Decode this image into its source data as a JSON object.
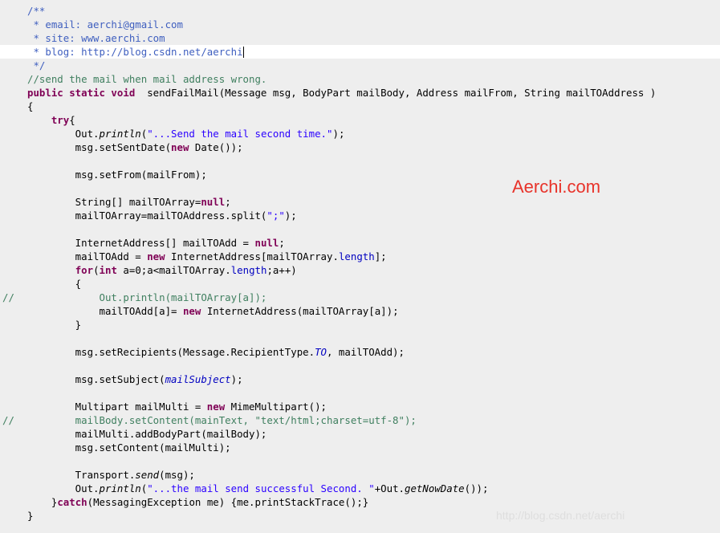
{
  "editor": {
    "lines": [
      {
        "gutter": "",
        "parts": [
          [
            "jd",
            "/**"
          ]
        ]
      },
      {
        "gutter": "",
        "parts": [
          [
            "jd",
            " * email: aerchi@gmail.com"
          ]
        ]
      },
      {
        "gutter": "",
        "parts": [
          [
            "jd",
            " * site: www.aerchi.com"
          ]
        ]
      },
      {
        "gutter": "",
        "current": true,
        "caret": true,
        "parts": [
          [
            "jd",
            " * blog: http://blog.csdn.net/aerchi"
          ]
        ]
      },
      {
        "gutter": "",
        "parts": [
          [
            "jd",
            " */"
          ]
        ]
      },
      {
        "gutter": "",
        "parts": [
          [
            "cm",
            "//send the mail when mail address wrong."
          ]
        ]
      },
      {
        "gutter": "",
        "parts": [
          [
            "kw",
            "public static void"
          ],
          [
            "",
            "  sendFailMail(Message msg, BodyPart mailBody, Address mailFrom, String mailTOAddress )"
          ]
        ]
      },
      {
        "gutter": "",
        "parts": [
          [
            "",
            "{"
          ]
        ]
      },
      {
        "gutter": "",
        "parts": [
          [
            "",
            "    "
          ],
          [
            "kw",
            "try"
          ],
          [
            "",
            "{"
          ]
        ]
      },
      {
        "gutter": "",
        "parts": [
          [
            "",
            "        Out."
          ],
          [
            "it",
            "println"
          ],
          [
            "",
            "("
          ],
          [
            "str",
            "\"...Send the mail second time.\""
          ],
          [
            "",
            ");"
          ]
        ]
      },
      {
        "gutter": "",
        "parts": [
          [
            "",
            "        msg.setSentDate("
          ],
          [
            "kw",
            "new"
          ],
          [
            "",
            " Date());"
          ]
        ]
      },
      {
        "gutter": "",
        "parts": [
          [
            "",
            ""
          ]
        ]
      },
      {
        "gutter": "",
        "parts": [
          [
            "",
            "        msg.setFrom(mailFrom);"
          ]
        ]
      },
      {
        "gutter": "",
        "parts": [
          [
            "",
            ""
          ]
        ]
      },
      {
        "gutter": "",
        "parts": [
          [
            "",
            "        String[] mailTOArray="
          ],
          [
            "kw",
            "null"
          ],
          [
            "",
            ";"
          ]
        ]
      },
      {
        "gutter": "",
        "parts": [
          [
            "",
            "        mailTOArray=mailTOAddress.split("
          ],
          [
            "str",
            "\";\""
          ],
          [
            "",
            ");"
          ]
        ]
      },
      {
        "gutter": "",
        "parts": [
          [
            "",
            ""
          ]
        ]
      },
      {
        "gutter": "",
        "parts": [
          [
            "",
            "        InternetAddress[] mailTOAdd = "
          ],
          [
            "kw",
            "null"
          ],
          [
            "",
            ";"
          ]
        ]
      },
      {
        "gutter": "",
        "parts": [
          [
            "",
            "        mailTOAdd = "
          ],
          [
            "kw",
            "new"
          ],
          [
            "",
            " InternetAddress[mailTOArray."
          ],
          [
            "fld",
            "length"
          ],
          [
            "",
            "];"
          ]
        ]
      },
      {
        "gutter": "",
        "parts": [
          [
            "",
            "        "
          ],
          [
            "kw",
            "for"
          ],
          [
            "",
            "("
          ],
          [
            "kw",
            "int"
          ],
          [
            "",
            " a=0;a<mailTOArray."
          ],
          [
            "fld",
            "length"
          ],
          [
            "",
            ";a++)"
          ]
        ]
      },
      {
        "gutter": "",
        "parts": [
          [
            "",
            "        {"
          ]
        ]
      },
      {
        "gutter": "//",
        "parts": [
          [
            "cm",
            "            Out.println(mailTOArray[a]);"
          ]
        ]
      },
      {
        "gutter": "",
        "parts": [
          [
            "",
            "            mailTOAdd[a]= "
          ],
          [
            "kw",
            "new"
          ],
          [
            "",
            " InternetAddress(mailTOArray[a]);"
          ]
        ]
      },
      {
        "gutter": "",
        "parts": [
          [
            "",
            "        }"
          ]
        ]
      },
      {
        "gutter": "",
        "parts": [
          [
            "",
            ""
          ]
        ]
      },
      {
        "gutter": "",
        "parts": [
          [
            "",
            "        msg.setRecipients(Message.RecipientType."
          ],
          [
            "fld it",
            "TO"
          ],
          [
            "",
            ", mailTOAdd);"
          ]
        ]
      },
      {
        "gutter": "",
        "parts": [
          [
            "",
            ""
          ]
        ]
      },
      {
        "gutter": "",
        "parts": [
          [
            "",
            "        msg.setSubject("
          ],
          [
            "fld it",
            "mailSubject"
          ],
          [
            "",
            ");"
          ]
        ]
      },
      {
        "gutter": "",
        "parts": [
          [
            "",
            ""
          ]
        ]
      },
      {
        "gutter": "",
        "parts": [
          [
            "",
            "        Multipart mailMulti = "
          ],
          [
            "kw",
            "new"
          ],
          [
            "",
            " MimeMultipart();"
          ]
        ]
      },
      {
        "gutter": "//",
        "parts": [
          [
            "cm",
            "        mailBody.setContent(mainText, \"text/html;charset=utf-8\");"
          ]
        ]
      },
      {
        "gutter": "",
        "parts": [
          [
            "",
            "        mailMulti.addBodyPart(mailBody);"
          ]
        ]
      },
      {
        "gutter": "",
        "parts": [
          [
            "",
            "        msg.setContent(mailMulti);"
          ]
        ]
      },
      {
        "gutter": "",
        "parts": [
          [
            "",
            ""
          ]
        ]
      },
      {
        "gutter": "",
        "parts": [
          [
            "",
            "        Transport."
          ],
          [
            "it",
            "send"
          ],
          [
            "",
            "(msg);"
          ]
        ]
      },
      {
        "gutter": "",
        "parts": [
          [
            "",
            "        Out."
          ],
          [
            "it",
            "println"
          ],
          [
            "",
            "("
          ],
          [
            "str",
            "\"...the mail send successful Second. \""
          ],
          [
            "",
            "+Out."
          ],
          [
            "it",
            "getNowDate"
          ],
          [
            "",
            "());"
          ]
        ]
      },
      {
        "gutter": "",
        "parts": [
          [
            "",
            "    }"
          ],
          [
            "kw",
            "catch"
          ],
          [
            "",
            "(MessagingException me) {me.printStackTrace();}"
          ]
        ]
      },
      {
        "gutter": "",
        "parts": [
          [
            "",
            "}"
          ]
        ]
      }
    ]
  },
  "watermark": {
    "text": "Aerchi.com",
    "color": "#e8332a"
  },
  "faint_watermark": {
    "text": "http://blog.csdn.net/aerchi"
  },
  "colors": {
    "background": "#eeeeee",
    "current_line": "#ffffff",
    "keyword": "#7f0055",
    "string": "#2a00ff",
    "comment": "#3f7f5f",
    "javadoc": "#3f5fbf",
    "field": "#0000c0"
  }
}
